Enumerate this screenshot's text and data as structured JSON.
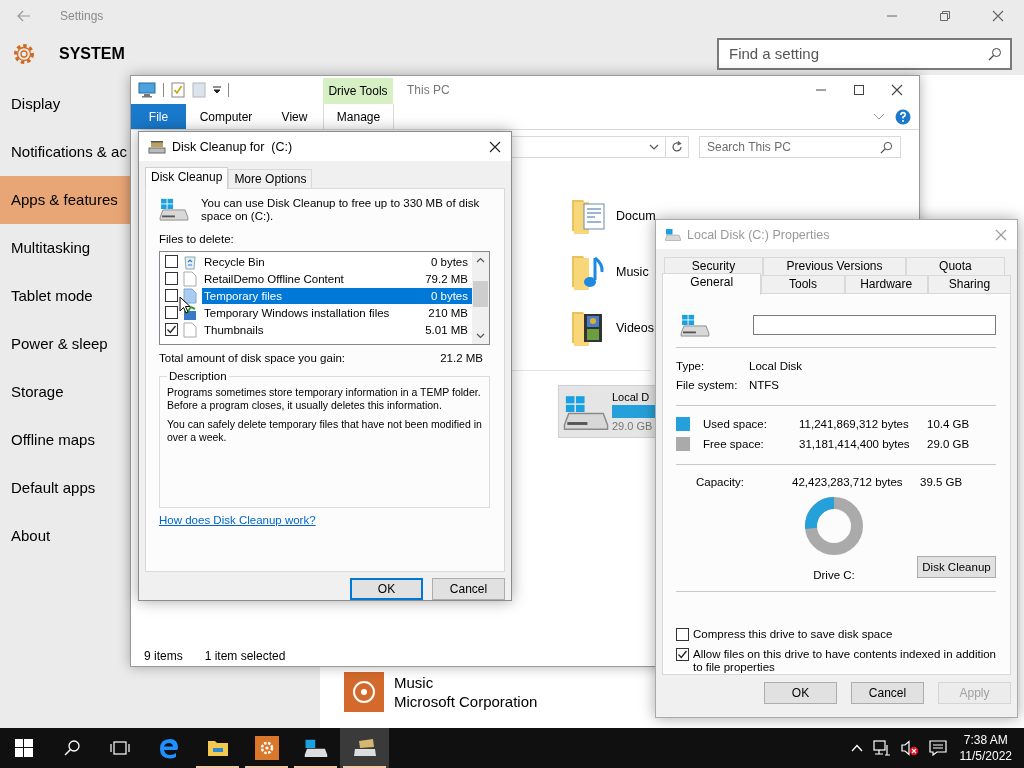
{
  "settings": {
    "title": "Settings",
    "header": "SYSTEM",
    "search": {
      "placeholder": "Find a setting"
    },
    "nav": [
      {
        "label": "Display",
        "selected": false
      },
      {
        "label": "Notifications & ac",
        "selected": false
      },
      {
        "label": "Apps & features",
        "selected": true
      },
      {
        "label": "Multitasking",
        "selected": false
      },
      {
        "label": "Tablet mode",
        "selected": false
      },
      {
        "label": "Power & sleep",
        "selected": false
      },
      {
        "label": "Storage",
        "selected": false
      },
      {
        "label": "Offline maps",
        "selected": false
      },
      {
        "label": "Default apps",
        "selected": false
      },
      {
        "label": "About",
        "selected": false
      }
    ],
    "apps": [
      {
        "name": "Music",
        "publisher": "Microsoft Corporation"
      }
    ]
  },
  "explorer": {
    "title": "This PC",
    "context_group": "Drive Tools",
    "ribbon_tabs": [
      {
        "label": "File",
        "kind": "file"
      },
      {
        "label": "Computer",
        "kind": "tab"
      },
      {
        "label": "View",
        "kind": "tab"
      },
      {
        "label": "Manage",
        "kind": "context"
      }
    ],
    "search": {
      "placeholder": "Search This PC"
    },
    "folders": [
      {
        "name": "Docum",
        "kind": "documents"
      },
      {
        "name": "Music",
        "kind": "music"
      },
      {
        "name": "Videos",
        "kind": "videos"
      }
    ],
    "drives": [
      {
        "name": "Local D",
        "free": "29.0 GB",
        "selected": true
      }
    ],
    "status": {
      "count": "9 items",
      "selection": "1 item selected"
    }
  },
  "disk_cleanup": {
    "title": "Disk Cleanup for  (C:)",
    "tabs": [
      {
        "label": "Disk Cleanup",
        "selected": true
      },
      {
        "label": "More Options",
        "selected": false
      }
    ],
    "intro": "You can use Disk Cleanup to free up to 330 MB of disk space on  (C:).",
    "files_label": "Files to delete:",
    "files": [
      {
        "name": "Recycle Bin",
        "size": "0 bytes",
        "kind": "recycle",
        "checked": false,
        "selected": false
      },
      {
        "name": "RetailDemo Offline Content",
        "size": "79.2 MB",
        "kind": "page",
        "checked": false,
        "selected": false
      },
      {
        "name": "Temporary files",
        "size": "0 bytes",
        "kind": "temp",
        "checked": false,
        "selected": true
      },
      {
        "name": "Temporary Windows installation files",
        "size": "210 MB",
        "kind": "setup",
        "checked": false,
        "selected": false
      },
      {
        "name": "Thumbnails",
        "size": "5.01 MB",
        "kind": "page",
        "checked": true,
        "selected": false
      }
    ],
    "total": {
      "label": "Total amount of disk space you gain:",
      "value": "21.2 MB"
    },
    "description": {
      "title": "Description",
      "paragraphs": [
        "Programs sometimes store temporary information in a TEMP folder. Before a program closes, it usually deletes this information.",
        "You can safely delete temporary files that have not been modified in over a week."
      ]
    },
    "help_link": "How does Disk Cleanup work?",
    "buttons": [
      {
        "label": "OK",
        "default": true
      },
      {
        "label": "Cancel",
        "default": false
      }
    ]
  },
  "properties": {
    "title": "Local Disk (C:) Properties",
    "tab_rows": [
      {
        "tabs": [
          {
            "label": "Security",
            "selected": false
          },
          {
            "label": "Previous Versions",
            "selected": false
          },
          {
            "label": "Quota",
            "selected": false
          }
        ]
      },
      {
        "tabs": [
          {
            "label": "General",
            "selected": true
          },
          {
            "label": "Tools",
            "selected": false
          },
          {
            "label": "Hardware",
            "selected": false
          },
          {
            "label": "Sharing",
            "selected": false
          }
        ]
      }
    ],
    "info": [
      {
        "label": "Type:",
        "value": "Local Disk"
      },
      {
        "label": "File system:",
        "value": "NTFS"
      }
    ],
    "space": [
      {
        "label": "Used space:",
        "bytes": "11,241,869,312 bytes",
        "size": "10.4 GB",
        "color": "#26a0da"
      },
      {
        "label": "Free space:",
        "bytes": "31,181,414,400 bytes",
        "size": "29.0 GB",
        "color": "#aaaaaa"
      }
    ],
    "capacity": {
      "label": "Capacity:",
      "bytes": "42,423,283,712 bytes",
      "size": "39.5 GB"
    },
    "drive_label": "Drive C:",
    "cleanup_button": "Disk Cleanup",
    "options": [
      {
        "label": "Compress this drive to save disk space",
        "checked": false
      },
      {
        "label": "Allow files on this drive to have contents indexed in addition to file properties",
        "checked": true
      }
    ],
    "buttons": [
      {
        "label": "OK",
        "disabled": false
      },
      {
        "label": "Cancel",
        "disabled": false
      },
      {
        "label": "Apply",
        "disabled": true
      }
    ]
  },
  "taskbar": {
    "apps": [
      {
        "kind": "edge",
        "running": false,
        "active": false
      },
      {
        "kind": "explorer",
        "running": true,
        "active": false
      },
      {
        "kind": "settings",
        "running": true,
        "active": false
      },
      {
        "kind": "drive",
        "running": true,
        "active": false
      },
      {
        "kind": "cleanup",
        "running": true,
        "active": true
      }
    ],
    "volume_muted": true,
    "time": "7:38 AM",
    "date": "11/5/2022"
  }
}
